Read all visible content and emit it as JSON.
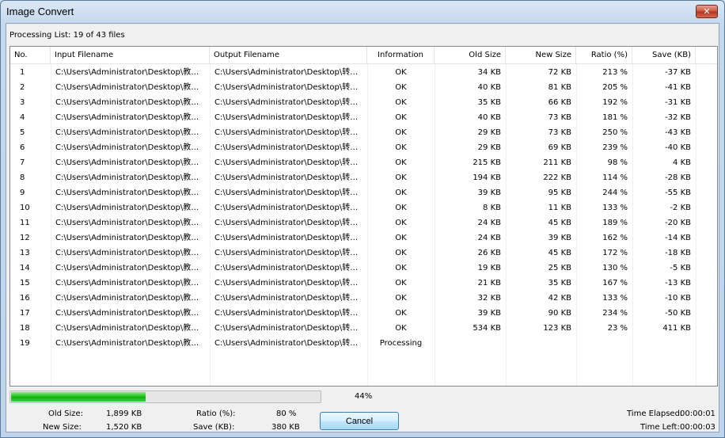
{
  "window": {
    "title": "Image Convert",
    "close_glyph": "✕"
  },
  "processing_label": "Processing List: 19 of 43 files",
  "columns": {
    "no": "No.",
    "input": "Input Filename",
    "output": "Output Filename",
    "info": "Information",
    "old_size": "Old Size",
    "new_size": "New Size",
    "ratio": "Ratio (%)",
    "save": "Save (KB)"
  },
  "rows": [
    {
      "no": "1",
      "input": "C:\\Users\\Administrator\\Desktop\\教…",
      "output": "C:\\Users\\Administrator\\Desktop\\转…",
      "info": "OK",
      "old": "34 KB",
      "new": "72 KB",
      "ratio": "213 %",
      "save": "-37 KB"
    },
    {
      "no": "2",
      "input": "C:\\Users\\Administrator\\Desktop\\教…",
      "output": "C:\\Users\\Administrator\\Desktop\\转…",
      "info": "OK",
      "old": "40 KB",
      "new": "81 KB",
      "ratio": "205 %",
      "save": "-41 KB"
    },
    {
      "no": "3",
      "input": "C:\\Users\\Administrator\\Desktop\\教…",
      "output": "C:\\Users\\Administrator\\Desktop\\转…",
      "info": "OK",
      "old": "35 KB",
      "new": "66 KB",
      "ratio": "192 %",
      "save": "-31 KB"
    },
    {
      "no": "4",
      "input": "C:\\Users\\Administrator\\Desktop\\教…",
      "output": "C:\\Users\\Administrator\\Desktop\\转…",
      "info": "OK",
      "old": "40 KB",
      "new": "73 KB",
      "ratio": "181 %",
      "save": "-32 KB"
    },
    {
      "no": "5",
      "input": "C:\\Users\\Administrator\\Desktop\\教…",
      "output": "C:\\Users\\Administrator\\Desktop\\转…",
      "info": "OK",
      "old": "29 KB",
      "new": "73 KB",
      "ratio": "250 %",
      "save": "-43 KB"
    },
    {
      "no": "6",
      "input": "C:\\Users\\Administrator\\Desktop\\教…",
      "output": "C:\\Users\\Administrator\\Desktop\\转…",
      "info": "OK",
      "old": "29 KB",
      "new": "69 KB",
      "ratio": "239 %",
      "save": "-40 KB"
    },
    {
      "no": "7",
      "input": "C:\\Users\\Administrator\\Desktop\\教…",
      "output": "C:\\Users\\Administrator\\Desktop\\转…",
      "info": "OK",
      "old": "215 KB",
      "new": "211 KB",
      "ratio": "98 %",
      "save": "4 KB"
    },
    {
      "no": "8",
      "input": "C:\\Users\\Administrator\\Desktop\\教…",
      "output": "C:\\Users\\Administrator\\Desktop\\转…",
      "info": "OK",
      "old": "194 KB",
      "new": "222 KB",
      "ratio": "114 %",
      "save": "-28 KB"
    },
    {
      "no": "9",
      "input": "C:\\Users\\Administrator\\Desktop\\教…",
      "output": "C:\\Users\\Administrator\\Desktop\\转…",
      "info": "OK",
      "old": "39 KB",
      "new": "95 KB",
      "ratio": "244 %",
      "save": "-55 KB"
    },
    {
      "no": "10",
      "input": "C:\\Users\\Administrator\\Desktop\\教…",
      "output": "C:\\Users\\Administrator\\Desktop\\转…",
      "info": "OK",
      "old": "8 KB",
      "new": "11 KB",
      "ratio": "133 %",
      "save": "-2 KB"
    },
    {
      "no": "11",
      "input": "C:\\Users\\Administrator\\Desktop\\教…",
      "output": "C:\\Users\\Administrator\\Desktop\\转…",
      "info": "OK",
      "old": "24 KB",
      "new": "45 KB",
      "ratio": "189 %",
      "save": "-20 KB"
    },
    {
      "no": "12",
      "input": "C:\\Users\\Administrator\\Desktop\\教…",
      "output": "C:\\Users\\Administrator\\Desktop\\转…",
      "info": "OK",
      "old": "24 KB",
      "new": "39 KB",
      "ratio": "162 %",
      "save": "-14 KB"
    },
    {
      "no": "13",
      "input": "C:\\Users\\Administrator\\Desktop\\教…",
      "output": "C:\\Users\\Administrator\\Desktop\\转…",
      "info": "OK",
      "old": "26 KB",
      "new": "45 KB",
      "ratio": "172 %",
      "save": "-18 KB"
    },
    {
      "no": "14",
      "input": "C:\\Users\\Administrator\\Desktop\\教…",
      "output": "C:\\Users\\Administrator\\Desktop\\转…",
      "info": "OK",
      "old": "19 KB",
      "new": "25 KB",
      "ratio": "130 %",
      "save": "-5 KB"
    },
    {
      "no": "15",
      "input": "C:\\Users\\Administrator\\Desktop\\教…",
      "output": "C:\\Users\\Administrator\\Desktop\\转…",
      "info": "OK",
      "old": "21 KB",
      "new": "35 KB",
      "ratio": "167 %",
      "save": "-13 KB"
    },
    {
      "no": "16",
      "input": "C:\\Users\\Administrator\\Desktop\\教…",
      "output": "C:\\Users\\Administrator\\Desktop\\转…",
      "info": "OK",
      "old": "32 KB",
      "new": "42 KB",
      "ratio": "133 %",
      "save": "-10 KB"
    },
    {
      "no": "17",
      "input": "C:\\Users\\Administrator\\Desktop\\教…",
      "output": "C:\\Users\\Administrator\\Desktop\\转…",
      "info": "OK",
      "old": "39 KB",
      "new": "90 KB",
      "ratio": "234 %",
      "save": "-50 KB"
    },
    {
      "no": "18",
      "input": "C:\\Users\\Administrator\\Desktop\\教…",
      "output": "C:\\Users\\Administrator\\Desktop\\转…",
      "info": "OK",
      "old": "534 KB",
      "new": "123 KB",
      "ratio": "23 %",
      "save": "411 KB"
    },
    {
      "no": "19",
      "input": "C:\\Users\\Administrator\\Desktop\\教…",
      "output": "C:\\Users\\Administrator\\Desktop\\转…",
      "info": "Processing",
      "old": "",
      "new": "",
      "ratio": "",
      "save": ""
    }
  ],
  "progress": {
    "fraction": 0.44,
    "label": "44%",
    "fill_color": "#1ec21e"
  },
  "stats": {
    "old_size_label": "Old Size:",
    "old_size_value": "1,899 KB",
    "new_size_label": "New Size:",
    "new_size_value": "1,520 KB",
    "ratio_label": "Ratio (%):",
    "ratio_value": "80 %",
    "save_label": "Save (KB):",
    "save_value": "380 KB",
    "time_elapsed_label": "Time Elapsed:",
    "time_elapsed_value": "00:00:01",
    "time_left_label": "Time Left:",
    "time_left_value": "00:00:03"
  },
  "buttons": {
    "cancel": "Cancel"
  }
}
